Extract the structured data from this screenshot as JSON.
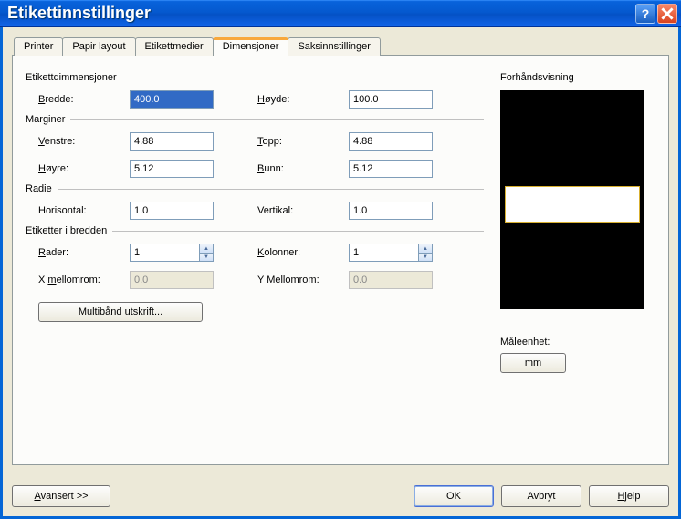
{
  "window": {
    "title": "Etikettinnstillinger"
  },
  "tabs": {
    "printer": "Printer",
    "paper": "Papir layout",
    "media": "Etikettmedier",
    "dimensions": "Dimensjoner",
    "scissors": "Saksinnstillinger"
  },
  "groups": {
    "labeldim": "Etikettdimmensjoner",
    "margins": "Marginer",
    "radius": "Radie",
    "across": "Etiketter i bredden",
    "preview": "Forhåndsvisning",
    "unit": "Måleenhet:"
  },
  "labeldim": {
    "width_label": "Bredde:",
    "width": "400.0",
    "height_label": "Høyde:",
    "height": "100.0"
  },
  "margins": {
    "left_label": "Venstre:",
    "left": "4.88",
    "top_label": "Topp:",
    "top": "4.88",
    "right_label": "Høyre:",
    "right": "5.12",
    "bottom_label": "Bunn:",
    "bottom": "5.12"
  },
  "radius": {
    "horiz_label": "Horisontal:",
    "horiz": "1.0",
    "vert_label": "Vertikal:",
    "vert": "1.0"
  },
  "across": {
    "rows_label": "Rader:",
    "rows": "1",
    "cols_label": "Kolonner:",
    "cols": "1",
    "xgap_label": "X mellomrom:",
    "xgap": "0.0",
    "ygap_label": "Y Mellomrom:",
    "ygap": "0.0"
  },
  "buttons": {
    "multiband": "Multibånd utskrift...",
    "unit": "mm",
    "advanced": "Avansert >>",
    "ok": "OK",
    "cancel": "Avbryt",
    "help": "Hjelp"
  }
}
